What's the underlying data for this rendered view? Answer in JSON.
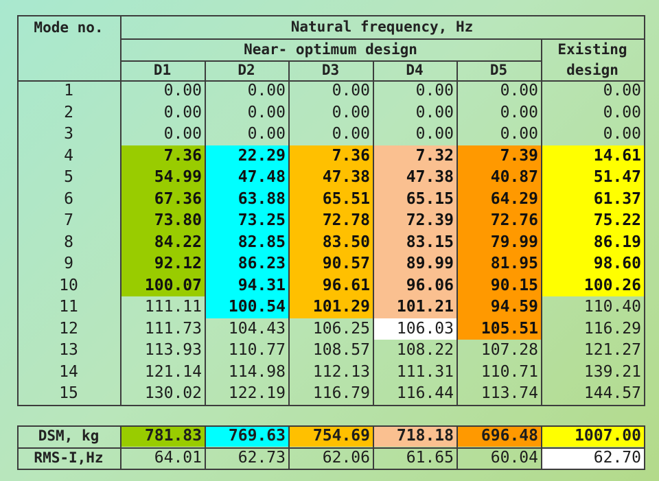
{
  "table": {
    "header": {
      "mode_label": "Mode no.",
      "group_label": "Natural frequency, Hz",
      "near_optimum_label": "Near- optimum design",
      "existing_label_1": "Existing",
      "existing_label_2": "design",
      "columns": [
        "D1",
        "D2",
        "D3",
        "D4",
        "D5"
      ]
    },
    "rows": [
      {
        "mode": "1",
        "values": [
          "0.00",
          "0.00",
          "0.00",
          "0.00",
          "0.00",
          "0.00"
        ]
      },
      {
        "mode": "2",
        "values": [
          "0.00",
          "0.00",
          "0.00",
          "0.00",
          "0.00",
          "0.00"
        ]
      },
      {
        "mode": "3",
        "values": [
          "0.00",
          "0.00",
          "0.00",
          "0.00",
          "0.00",
          "0.00"
        ]
      },
      {
        "mode": "4",
        "values": [
          "7.36",
          "22.29",
          "7.36",
          "7.32",
          "7.39",
          "14.61"
        ]
      },
      {
        "mode": "5",
        "values": [
          "54.99",
          "47.48",
          "47.38",
          "47.38",
          "40.87",
          "51.47"
        ]
      },
      {
        "mode": "6",
        "values": [
          "67.36",
          "63.88",
          "65.51",
          "65.15",
          "64.29",
          "61.37"
        ]
      },
      {
        "mode": "7",
        "values": [
          "73.80",
          "73.25",
          "72.78",
          "72.39",
          "72.76",
          "75.22"
        ]
      },
      {
        "mode": "8",
        "values": [
          "84.22",
          "82.85",
          "83.50",
          "83.15",
          "79.99",
          "86.19"
        ]
      },
      {
        "mode": "9",
        "values": [
          "92.12",
          "86.23",
          "90.57",
          "89.99",
          "81.95",
          "98.60"
        ]
      },
      {
        "mode": "10",
        "values": [
          "100.07",
          "94.31",
          "96.61",
          "96.06",
          "90.15",
          "100.26"
        ]
      },
      {
        "mode": "11",
        "values": [
          "111.11",
          "100.54",
          "101.29",
          "101.21",
          "94.59",
          "110.40"
        ]
      },
      {
        "mode": "12",
        "values": [
          "111.73",
          "104.43",
          "106.25",
          "106.03",
          "105.51",
          "116.29"
        ]
      },
      {
        "mode": "13",
        "values": [
          "113.93",
          "110.77",
          "108.57",
          "108.22",
          "107.28",
          "121.27"
        ]
      },
      {
        "mode": "14",
        "values": [
          "121.14",
          "114.98",
          "112.13",
          "111.31",
          "110.71",
          "139.21"
        ]
      },
      {
        "mode": "15",
        "values": [
          "130.02",
          "122.19",
          "116.79",
          "116.44",
          "113.74",
          "144.57"
        ]
      }
    ],
    "highlight_rows": {
      "D1": [
        4,
        10
      ],
      "D2": [
        4,
        11
      ],
      "D3": [
        4,
        11
      ],
      "D4": [
        4,
        11
      ],
      "D5": [
        4,
        12
      ],
      "Existing": [
        4,
        10
      ]
    },
    "white_cells": [
      [
        "12",
        "D4"
      ]
    ],
    "summary": [
      {
        "label": "DSM, kg",
        "values": [
          "781.83",
          "769.63",
          "754.69",
          "718.18",
          "696.48",
          "1007.00"
        ],
        "highlighted": true
      },
      {
        "label": "RMS-I,Hz",
        "values": [
          "64.01",
          "62.73",
          "62.06",
          "61.65",
          "60.04",
          "62.70"
        ],
        "highlighted": false
      }
    ]
  },
  "colors": {
    "D1": "#99cc00",
    "D2": "#00ffff",
    "D3": "#ffc000",
    "D4": "#fac090",
    "D5": "#ff9900",
    "Existing": "#ffff00",
    "white": "#ffffff",
    "rms_existing": "#ffffff"
  }
}
